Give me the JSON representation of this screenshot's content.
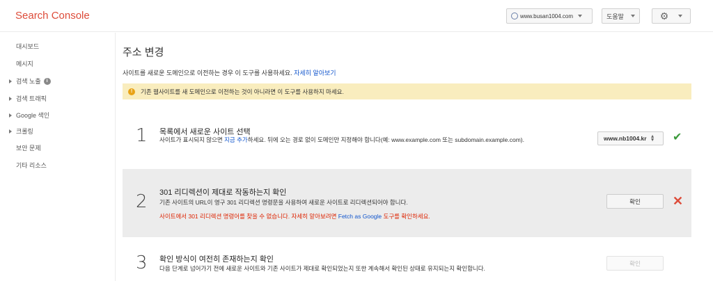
{
  "app": {
    "title": "Search Console"
  },
  "header": {
    "site_selector": "www.busan1004.com",
    "help_label": "도움말",
    "settings_icon": "gear-icon"
  },
  "sidebar": {
    "items": [
      {
        "label": "대시보드",
        "expandable": false
      },
      {
        "label": "메시지",
        "expandable": false
      },
      {
        "label": "검색 노출",
        "expandable": true,
        "info": true
      },
      {
        "label": "검색 트래픽",
        "expandable": true
      },
      {
        "label": "Google 색인",
        "expandable": true
      },
      {
        "label": "크롤링",
        "expandable": true
      },
      {
        "label": "보안 문제",
        "expandable": false
      },
      {
        "label": "기타 리소스",
        "expandable": false
      }
    ]
  },
  "main": {
    "title": "주소 변경",
    "intro_text": "사이트를 새로운 도메인으로 이전하는 경우 이 도구를 사용하세요.",
    "intro_link": "자세히 알아보기",
    "warning": "기존 웹사이트를 새 도메인으로 이전하는 것이 아니라면 이 도구를 사용하지 마세요.",
    "colors": {
      "warning_bg": "#f9edbe",
      "error": "#dd2200",
      "success": "#3c9a3c",
      "link": "#1155cc"
    },
    "steps": [
      {
        "number": "1",
        "title": "목록에서 새로운 사이트 선택",
        "desc_before": "사이트가 표시되지 않으면 ",
        "desc_link": "지금 추가",
        "desc_after": "하세요. 뒤에 오는 경로 없이 도메인만 지정해야 합니다(예: www.example.com 또는 subdomain.example.com).",
        "select_value": "www.nb1004.kr",
        "status": "success"
      },
      {
        "number": "2",
        "title": "301 리디렉션이 제대로 작동하는지 확인",
        "desc": "기존 사이트의 URL이 영구 301 리디렉션 명령문을 사용하여 새로운 사이트로 리디렉션되어야 합니다.",
        "error_before": "사이트에서 301 리디렉션 명령어를 찾을 수 없습니다. 자세히 알아보려면 ",
        "error_link": "Fetch as Google",
        "error_after": " 도구를 확인하세요.",
        "button_label": "확인",
        "status": "error"
      },
      {
        "number": "3",
        "title": "확인 방식이 여전히 존재하는지 확인",
        "desc": "다음 단계로 넘어가기 전에 새로운 사이트와 기존 사이트가 제대로 확인되었는지 또한 계속해서 확인된 상태로 유지되는지 확인합니다.",
        "button_label": "확인",
        "status": "disabled"
      }
    ]
  }
}
